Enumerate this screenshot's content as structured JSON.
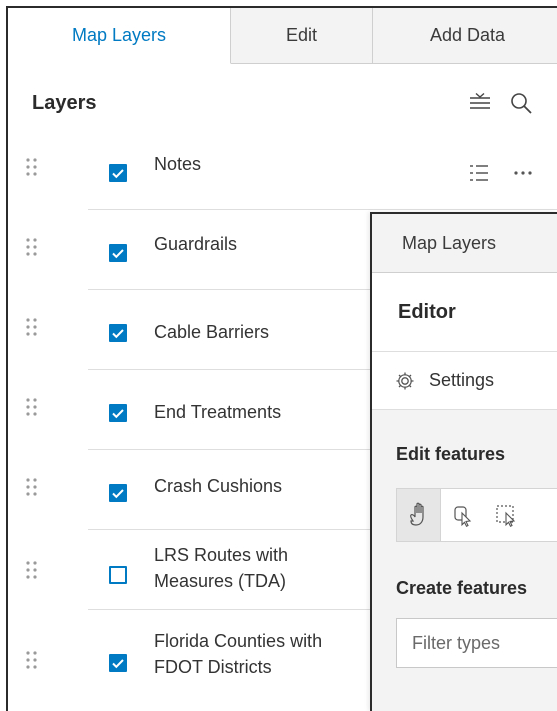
{
  "left_panel": {
    "tabs": [
      {
        "label": "Map Layers",
        "active": true
      },
      {
        "label": "Edit",
        "active": false
      },
      {
        "label": "Add Data",
        "active": false
      }
    ],
    "title": "Layers",
    "header_icons": [
      "list-collapse-icon",
      "search-icon"
    ],
    "layers": [
      {
        "label_lines": [
          "Notes"
        ],
        "checked": true,
        "icons": [
          "legend-list-icon",
          "more-options-icon"
        ]
      },
      {
        "label_lines": [
          "Guardrails"
        ],
        "checked": true
      },
      {
        "label_lines": [
          "Cable Barriers"
        ],
        "checked": true
      },
      {
        "label_lines": [
          "End Treatments"
        ],
        "checked": true
      },
      {
        "label_lines": [
          "Crash Cushions"
        ],
        "checked": true
      },
      {
        "label_lines": [
          "LRS Routes with",
          "Measures (TDA)"
        ],
        "checked": false
      },
      {
        "label_lines": [
          "Florida Counties with",
          "FDOT Districts"
        ],
        "checked": true
      }
    ]
  },
  "right_panel": {
    "tab": "Map Layers",
    "title": "Editor",
    "settings_label": "Settings",
    "edit_features_title": "Edit features",
    "tools": [
      "pan-hand-icon",
      "select-pointer-icon",
      "select-rectangle-icon"
    ],
    "create_features_title": "Create features",
    "filter_placeholder": "Filter types"
  },
  "colors": {
    "accent": "#007ac2",
    "tab_inactive_bg": "#f3f3f3",
    "separator": "#dedede"
  }
}
